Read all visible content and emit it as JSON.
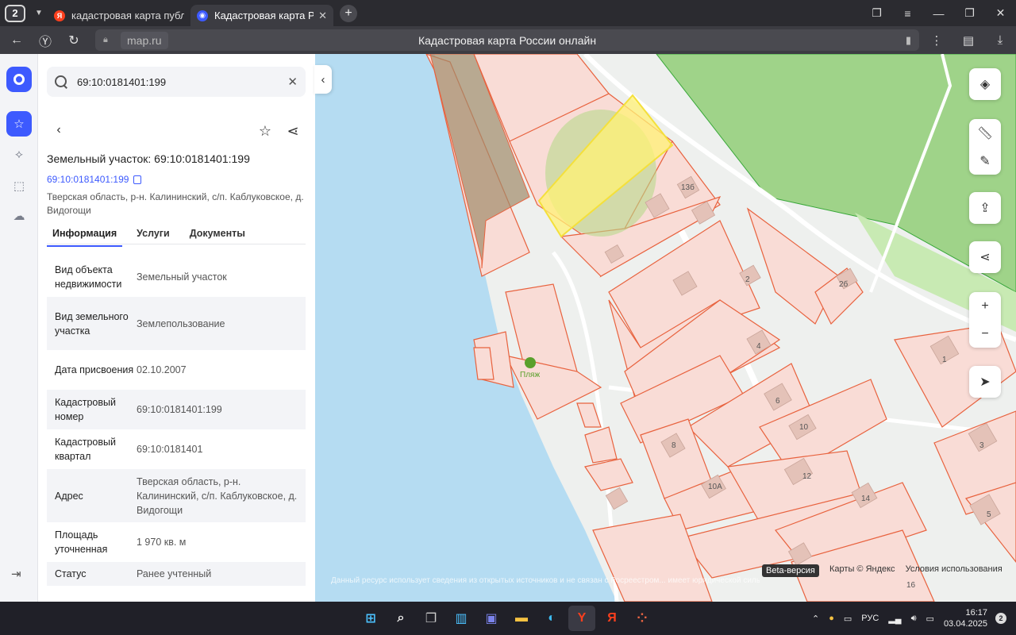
{
  "browser": {
    "tab_count": "2",
    "tabs": [
      {
        "title": "кадастровая карта публи",
        "favicon": "Я",
        "color": "#fc3f1d",
        "active": false
      },
      {
        "title": "Кадастровая карта Рос",
        "favicon": "◉",
        "color": "#3d5afe",
        "active": true
      }
    ],
    "url": "map.ru",
    "page_title": "Кадастровая карта России онлайн"
  },
  "search": {
    "value": "69:10:0181401:199"
  },
  "object": {
    "title": "Земельный участок: 69:10:0181401:199",
    "cad_number": "69:10:0181401:199",
    "address": "Тверская область, р-н. Калининский, с/п. Каблуковское, д. Видогощи"
  },
  "tabs": [
    "Информация",
    "Услуги",
    "Документы"
  ],
  "info_rows": [
    {
      "key": "Вид объекта недвижимости",
      "value": "Земельный участок"
    },
    {
      "key": "Вид земельного участка",
      "value": "Землепользование"
    },
    {
      "key": "Дата присвоения",
      "value": "02.10.2007"
    },
    {
      "key": "Кадастровый номер",
      "value": "69:10:0181401:199"
    },
    {
      "key": "Кадастровый квартал",
      "value": "69:10:0181401"
    },
    {
      "key": "Адрес",
      "value": "Тверская область, р-н. Калининский, с/п. Каблуковское, д. Видогощи"
    },
    {
      "key": "Площадь уточненная",
      "value": "1 970 кв. м"
    },
    {
      "key": "Статус",
      "value": "Ранее учтенный"
    }
  ],
  "map": {
    "beach_label": "Пляж",
    "house_numbers": [
      "13б",
      "2",
      "2б",
      "4",
      "6",
      "10",
      "8",
      "10А",
      "12",
      "14",
      "16",
      "1",
      "3",
      "5"
    ],
    "beta_label": "Beta-версия",
    "copyright": "Карты © Яндекс",
    "terms": "Условия использования",
    "disclaimer": "Данный ресурс использует сведения из открытых источников и не связан с Росреестром... имеет юридической силы. За официальными сведениями обращайтесь в Росреестр",
    "colors": {
      "water": "#b5dcf2",
      "park": "#9fd389",
      "parcel": "#f9dcd6",
      "parcel_border": "#e8623e",
      "selected": "#fff176"
    }
  },
  "taskbar": {
    "lang": "РУС",
    "time": "16:17",
    "date": "03.04.2025",
    "notifications": "2"
  }
}
